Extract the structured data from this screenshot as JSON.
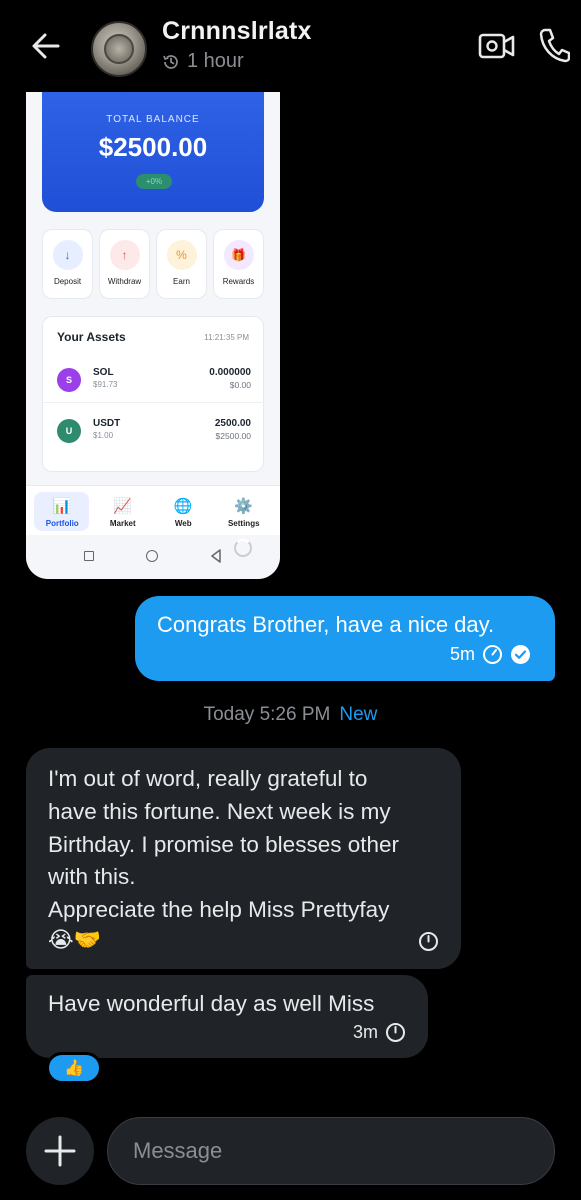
{
  "header": {
    "contact_name": "Crnnnslrlatx",
    "last_seen": "1 hour"
  },
  "screenshot": {
    "balance_label": "TOTAL BALANCE",
    "balance_value": "$2500.00",
    "balance_change": "+0%",
    "actions": [
      {
        "label": "Deposit",
        "icon": "↓"
      },
      {
        "label": "Withdraw",
        "icon": "↑"
      },
      {
        "label": "Earn",
        "icon": "%"
      },
      {
        "label": "Rewards",
        "icon": "🎁"
      }
    ],
    "assets_title": "Your Assets",
    "assets_time": "11:21:35 PM",
    "assets": [
      {
        "letter": "S",
        "name": "SOL",
        "price": "$91.73",
        "amount": "0.000000",
        "usd": "$0.00",
        "color": "#9b3fe8"
      },
      {
        "letter": "U",
        "name": "USDT",
        "price": "$1.00",
        "amount": "2500.00",
        "usd": "$2500.00",
        "color": "#2e8b6e"
      }
    ],
    "nav": [
      {
        "label": "Portfolio",
        "icon": "📊"
      },
      {
        "label": "Market",
        "icon": "📈"
      },
      {
        "label": "Web",
        "icon": "🌐"
      },
      {
        "label": "Settings",
        "icon": "⚙️"
      }
    ]
  },
  "messages": {
    "outgoing_text": "Congrats Brother, have a nice day.",
    "outgoing_time": "5m",
    "day_separator": "Today 5:26 PM",
    "new_label": "New",
    "incoming_1_text": "I'm out of word, really grateful to\nhave this fortune. Next week is my\nBirthday. I promise to blesses other\nwith this.\nAppreciate the help Miss Prettyfay",
    "incoming_1_emoji": "😭🤝",
    "incoming_2_text": "Have wonderful day as well Miss",
    "incoming_2_time": "3m",
    "reaction": "👍"
  },
  "composer": {
    "placeholder": "Message"
  },
  "colors": {
    "accent": "#1d9bf0",
    "bubble_in": "#202327",
    "background": "#000000"
  }
}
